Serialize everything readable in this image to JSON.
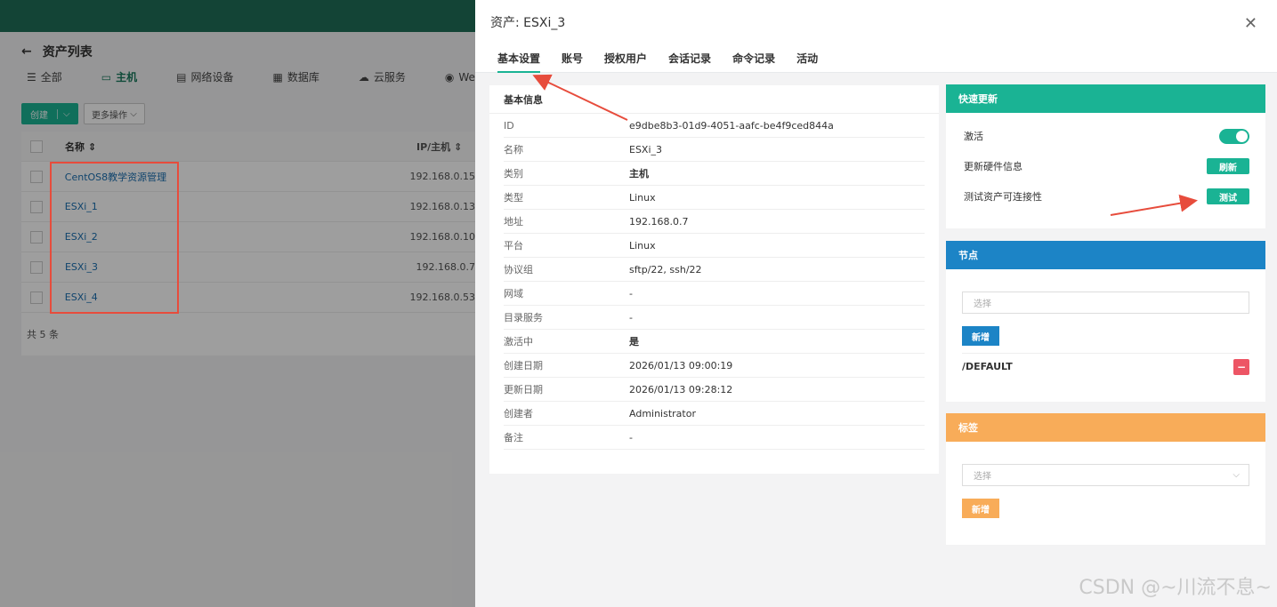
{
  "background": {
    "header": {
      "back_icon": "arrow-left-icon",
      "title": "资产列表"
    },
    "tabs": [
      {
        "label": "全部",
        "icon": "menu-icon"
      },
      {
        "label": "主机",
        "icon": "monitor-icon"
      },
      {
        "label": "网络设备",
        "icon": "server-icon"
      },
      {
        "label": "数据库",
        "icon": "database-icon"
      },
      {
        "label": "云服务",
        "icon": "cloud-icon"
      },
      {
        "label": "Web",
        "icon": "globe-icon"
      }
    ],
    "toolbar": {
      "create_label": "创建",
      "more_label": "更多操作"
    },
    "table": {
      "columns": [
        "名称",
        "IP/主机"
      ],
      "rows": [
        {
          "name": "CentOS8教学资源管理",
          "ip": "192.168.0.15"
        },
        {
          "name": "ESXi_1",
          "ip": "192.168.0.13"
        },
        {
          "name": "ESXi_2",
          "ip": "192.168.0.10"
        },
        {
          "name": "ESXi_3",
          "ip": "192.168.0.7"
        },
        {
          "name": "ESXi_4",
          "ip": "192.168.0.53"
        }
      ],
      "footer": "共 5 条"
    }
  },
  "drawer": {
    "title": "资产: ESXi_3",
    "tabs": [
      "基本设置",
      "账号",
      "授权用户",
      "会话记录",
      "命令记录",
      "活动"
    ],
    "info": {
      "title": "基本信息",
      "rows": [
        {
          "key": "ID",
          "value": "e9dbe8b3-01d9-4051-aafc-be4f9ced844a"
        },
        {
          "key": "名称",
          "value": "ESXi_3"
        },
        {
          "key": "类别",
          "value": "主机"
        },
        {
          "key": "类型",
          "value": "Linux"
        },
        {
          "key": "地址",
          "value": "192.168.0.7"
        },
        {
          "key": "平台",
          "value": "Linux"
        },
        {
          "key": "协议组",
          "value": "sftp/22, ssh/22"
        },
        {
          "key": "网域",
          "value": "-"
        },
        {
          "key": "目录服务",
          "value": "-"
        },
        {
          "key": "激活中",
          "value": "是"
        },
        {
          "key": "创建日期",
          "value": "2026/01/13 09:00:19"
        },
        {
          "key": "更新日期",
          "value": "2026/01/13 09:28:12"
        },
        {
          "key": "创建者",
          "value": "Administrator"
        },
        {
          "key": "备注",
          "value": "-"
        }
      ]
    },
    "quick_update": {
      "title": "快速更新",
      "active_label": "激活",
      "active": true,
      "hardware_label": "更新硬件信息",
      "refresh_button": "刷新",
      "test_label": "测试资产可连接性",
      "test_button": "测试"
    },
    "nodes": {
      "title": "节点",
      "select_placeholder": "选择",
      "add_button": "新增",
      "items": [
        "/DEFAULT"
      ]
    },
    "tags": {
      "title": "标签",
      "select_placeholder": "选择",
      "add_button": "新增"
    }
  },
  "credit": "CSDN @~川流不息~",
  "colors": {
    "green": "#1ab394",
    "blue": "#1c84c6",
    "orange": "#f8ac59",
    "red": "#ed5565",
    "annotation": "#e74c3c"
  }
}
